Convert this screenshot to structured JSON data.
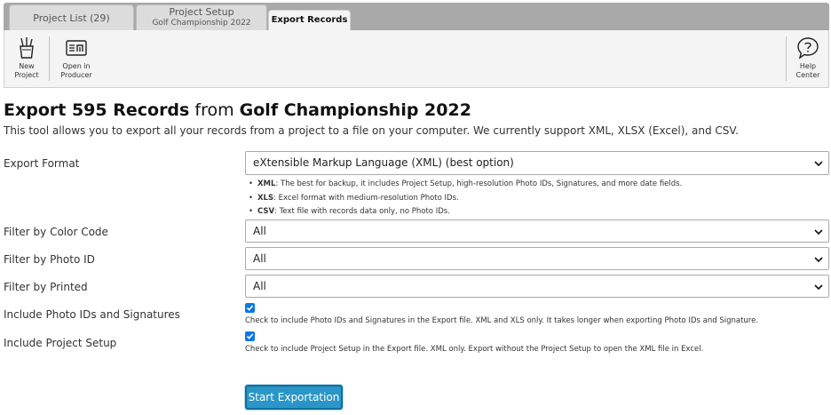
{
  "tabs": [
    {
      "label": "Project List (29)"
    },
    {
      "label": "Project Setup",
      "sublabel": "Golf Championship 2022"
    },
    {
      "label": "Export Records"
    }
  ],
  "toolbar": {
    "new_project_l1": "New",
    "new_project_l2": "Project",
    "open_producer_l1": "Open in",
    "open_producer_l2": "Producer",
    "help_l1": "Help",
    "help_l2": "Center"
  },
  "heading": {
    "prefix": "Export 595 Records",
    "middle": "from",
    "project": "Golf Championship 2022"
  },
  "description": "This tool allows you to export all your records from a project to a file on your computer. We currently support XML, XLSX (Excel), and CSV.",
  "form": {
    "export_format": {
      "label": "Export Format",
      "value": "eXtensible Markup Language (XML) (best option)"
    },
    "hints": [
      {
        "key": "XML",
        "text": ": The best for backup, it includes Project Setup, high-resolution Photo IDs, Signatures, and more date fields."
      },
      {
        "key": "XLS",
        "text": ": Excel format with medium-resolution Photo IDs."
      },
      {
        "key": "CSV",
        "text": ": Text file with records data only, no Photo IDs."
      }
    ],
    "color_code": {
      "label": "Filter by Color Code",
      "value": "All"
    },
    "photo_id": {
      "label": "Filter by Photo ID",
      "value": "All"
    },
    "printed": {
      "label": "Filter by Printed",
      "value": "All"
    },
    "include_photos": {
      "label": "Include Photo IDs and Signatures",
      "checked": true,
      "note": "Check to include Photo IDs and Signatures in the Export file. XML and XLS only. It takes longer when exporting Photo IDs and Signature."
    },
    "include_setup": {
      "label": "Include Project Setup",
      "checked": true,
      "note": "Check to include Project Setup in the Export file. XML only. Export without the Project Setup to open the XML file in Excel."
    }
  },
  "start_button": "Start Exportation",
  "colors": {
    "accent": "#2a96c8",
    "checkbox": "#0a7ae6",
    "tabbar": "#a9a9a9"
  }
}
